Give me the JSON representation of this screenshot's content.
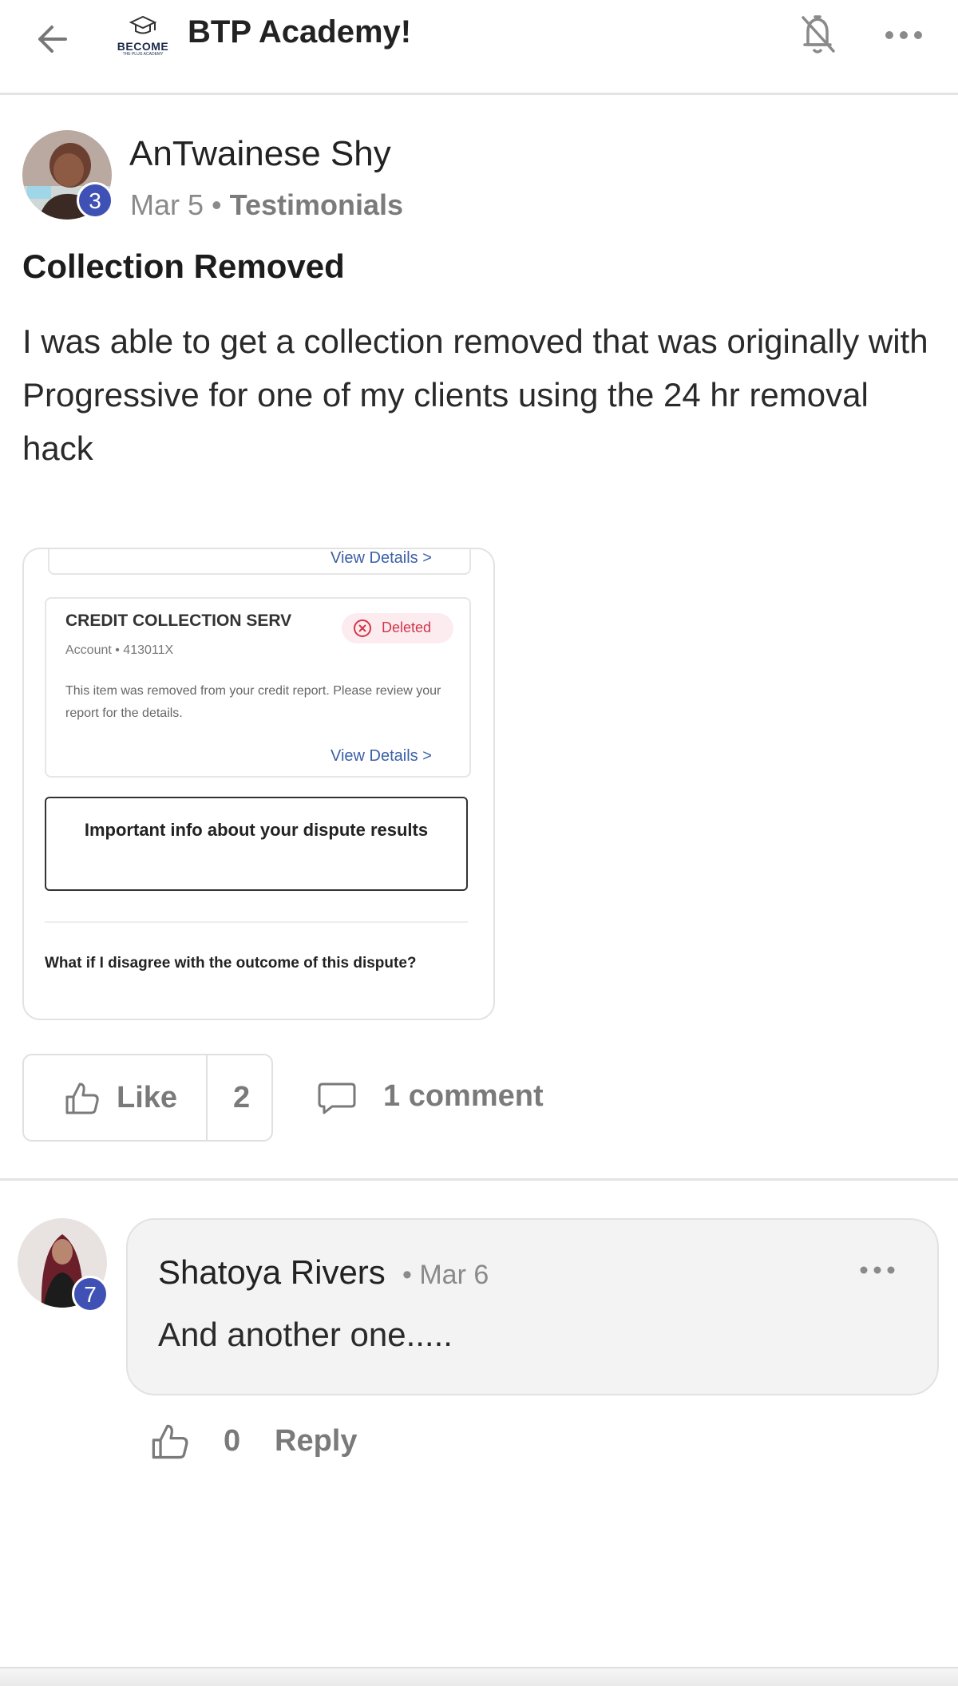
{
  "header": {
    "title": "BTP Academy!",
    "logo_text": "BECOME",
    "logo_subtext": "THE PLUG ACADEMY",
    "back_icon": "arrow-left-icon",
    "bell_icon": "bell-off-icon",
    "more_icon": "more-horizontal-icon"
  },
  "post": {
    "author": "AnTwainese Shy",
    "level": "3",
    "date": "Mar 5",
    "separator": "•",
    "category": "Testimonials",
    "title": "Collection Removed",
    "body": "I was able to get a collection removed that was originally with Progressive for one of my clients using the 24 hr removal hack",
    "attachment": {
      "view_details_top": "View Details",
      "creditor": "CREDIT COLLECTION SERV",
      "account": "Account • 413011X",
      "status": "Deleted",
      "description": "This item was removed from your credit report. Please review your report for the details.",
      "view_details": "View Details",
      "info_button": "Important info about your dispute results",
      "faq": "What if I disagree with the outcome of this dispute?"
    },
    "like_label": "Like",
    "like_count": "2",
    "comment_count": "1 comment"
  },
  "comment": {
    "author": "Shatoya Rivers",
    "level": "7",
    "date": "• Mar 6",
    "text": "And another one.....",
    "like_count": "0",
    "reply_label": "Reply"
  },
  "colors": {
    "badge": "#3f51b5",
    "link": "#3b5fa8",
    "deleted": "#d2354a",
    "muted": "#7a7a7a"
  }
}
